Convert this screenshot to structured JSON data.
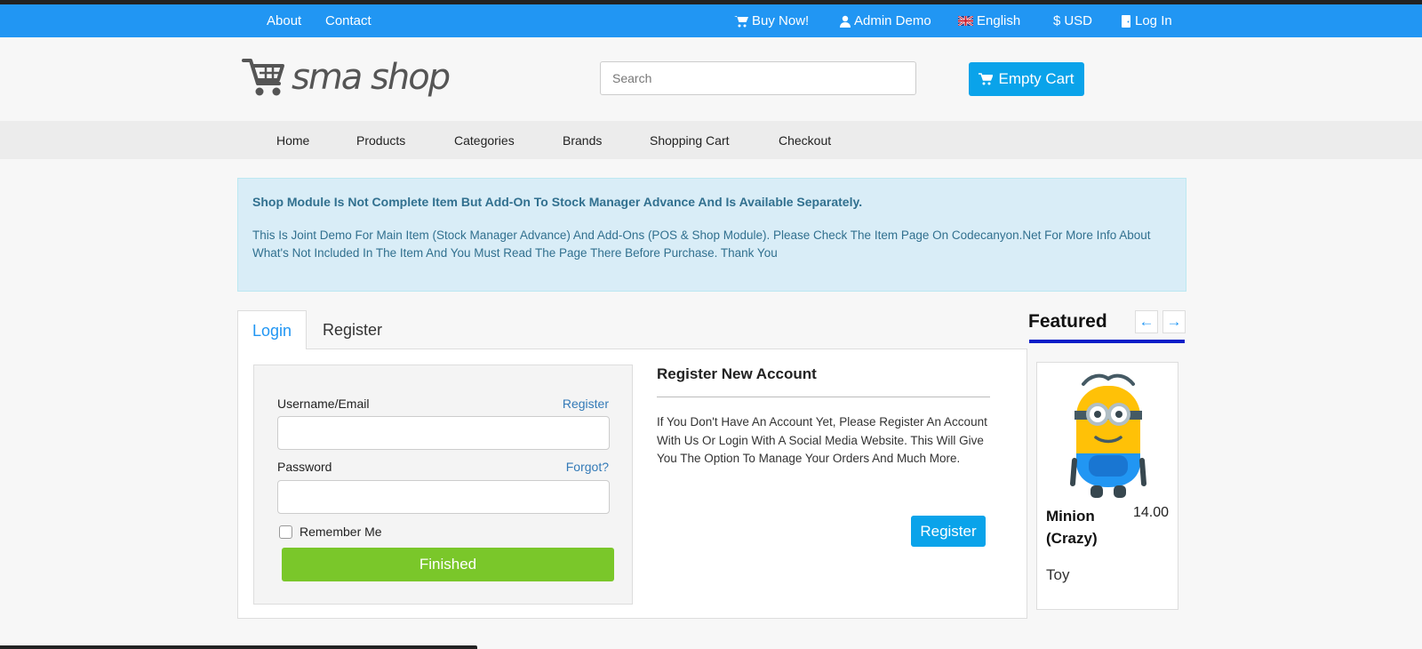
{
  "topbar": {
    "about": "About",
    "contact": "Contact",
    "buy_now": "Buy Now!",
    "user": "Admin Demo",
    "language": "English",
    "currency": "USD",
    "login": "Log In"
  },
  "header": {
    "logo_text": "sma shop",
    "search_placeholder": "Search",
    "cart_label": "Empty Cart"
  },
  "nav": [
    "Home",
    "Products",
    "Categories",
    "Brands",
    "Shopping Cart",
    "Checkout"
  ],
  "alert": {
    "title": "Shop Module Is Not Complete Item But Add-On To Stock Manager Advance And Is Available Separately.",
    "body": "This Is Joint Demo For Main Item (Stock Manager Advance) And Add-Ons (POS & Shop Module). Please Check The Item Page On Codecanyon.Net For More Info About What's Not Included In The Item And You Must Read The Page There Before Purchase. Thank You"
  },
  "tabs": [
    "Login",
    "Register"
  ],
  "login_form": {
    "username_label": "Username/Email",
    "register_link": "Register",
    "password_label": "Password",
    "forgot_link": "Forgot?",
    "remember_label": "Remember Me",
    "submit_label": "Finished"
  },
  "register_section": {
    "title": "Register New Account",
    "text": "If You Don't Have An Account Yet, Please Register An Account With Us Or Login With A Social Media Website. This Will Give You The Option To Manage Your Orders And Much More.",
    "button": "Register"
  },
  "featured": {
    "title": "Featured",
    "prev_icon": "←",
    "next_icon": "→",
    "product": {
      "name": "Minion (Crazy)",
      "price": "14.00",
      "category": "Toy"
    }
  },
  "colors": {
    "topbar": "#2196f3",
    "primary_button": "#0aa3ea",
    "finished_button": "#7ac72a",
    "alert_bg": "#d9edf7",
    "featured_bar": "#0a1ec8"
  }
}
